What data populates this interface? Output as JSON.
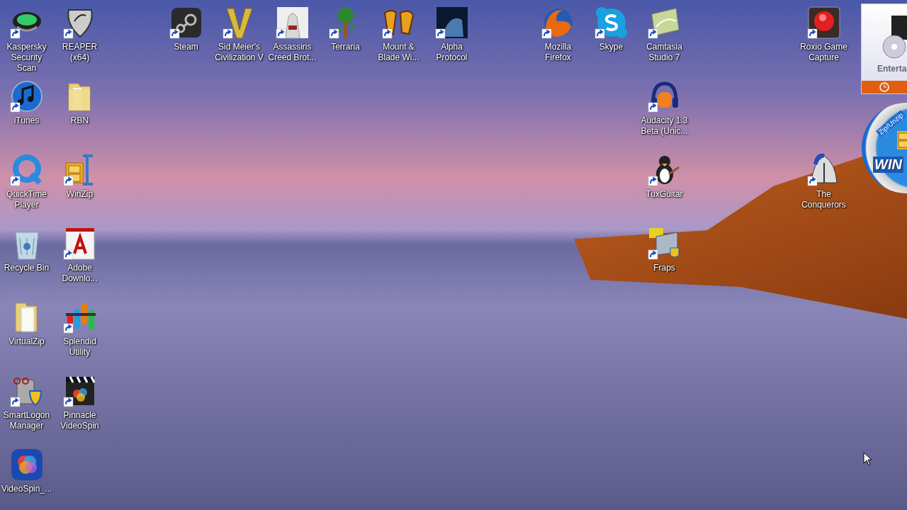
{
  "desktop": {
    "icons": [
      {
        "label": "Kaspersky Security Scan",
        "shortcut": true
      },
      {
        "label": "REAPER (x64)",
        "shortcut": true
      },
      {
        "label": "Steam",
        "shortcut": true
      },
      {
        "label": "Sid Meier's Civilization V",
        "shortcut": true
      },
      {
        "label": "Assassins Creed Brot...",
        "shortcut": true
      },
      {
        "label": "Terraria",
        "shortcut": true
      },
      {
        "label": "Mount & Blade Wi...",
        "shortcut": true
      },
      {
        "label": "Alpha Protocol",
        "shortcut": true
      },
      {
        "label": "Mozilla Firefox",
        "shortcut": true
      },
      {
        "label": "Skype",
        "shortcut": true
      },
      {
        "label": "Camtasia Studio 7",
        "shortcut": true
      },
      {
        "label": "Roxio Game Capture",
        "shortcut": true
      },
      {
        "label": "iTunes",
        "shortcut": true
      },
      {
        "label": "RBN",
        "shortcut": false
      },
      {
        "label": "Audacity 1.3 Beta (Unic...",
        "shortcut": true
      },
      {
        "label": "QuickTime Player",
        "shortcut": true
      },
      {
        "label": "WinZip",
        "shortcut": true
      },
      {
        "label": "TuxGuitar",
        "shortcut": true
      },
      {
        "label": "The Conquerors",
        "shortcut": true
      },
      {
        "label": "Recycle Bin",
        "shortcut": false
      },
      {
        "label": "Adobe Downlo...",
        "shortcut": true
      },
      {
        "label": "Fraps",
        "shortcut": true
      },
      {
        "label": "VirtualZip",
        "shortcut": false
      },
      {
        "label": "Splendid Utility",
        "shortcut": true
      },
      {
        "label": "SmartLogon Manager",
        "shortcut": true
      },
      {
        "label": "Pinnacle VideoSpin",
        "shortcut": true
      },
      {
        "label": "VideoSpin_...",
        "shortcut": false
      }
    ],
    "gadgets": [
      {
        "kind": "media-panel",
        "label": "Enterta"
      },
      {
        "kind": "zip-disc",
        "caption": "Zip/Unzip",
        "logo": "WIN"
      }
    ]
  }
}
